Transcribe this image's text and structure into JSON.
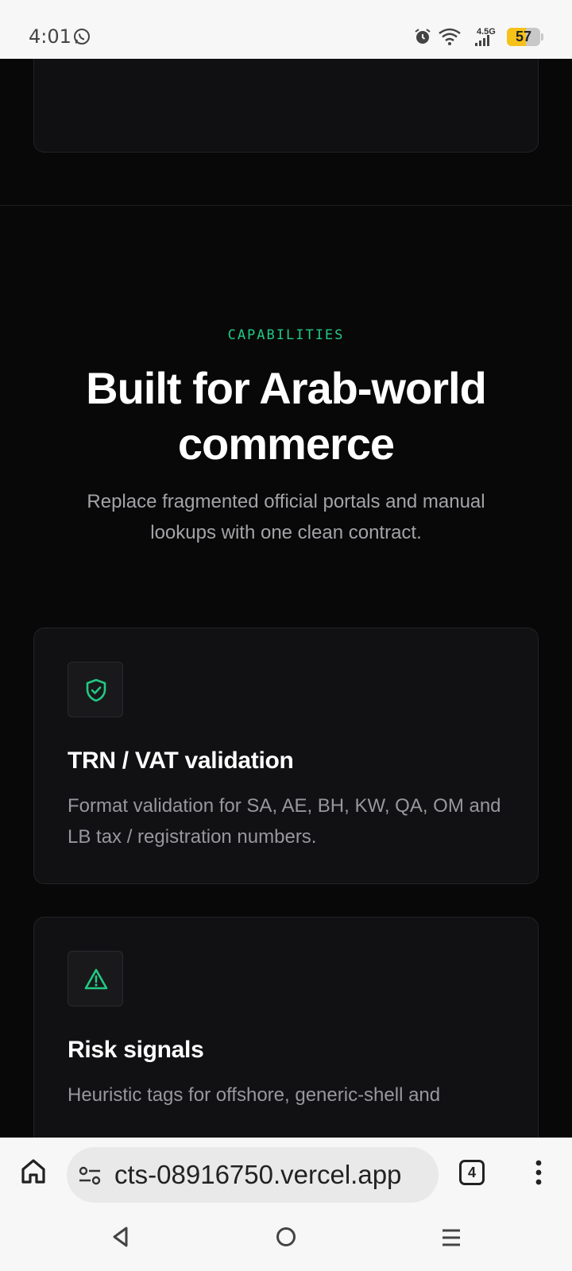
{
  "status_bar": {
    "time": "4:01",
    "network": "4.5G",
    "battery": "57",
    "battery_level": 0.57,
    "icons": [
      "whatsapp-icon",
      "alarm-icon",
      "wifi-icon",
      "signal-icon",
      "battery-icon"
    ]
  },
  "page": {
    "eyebrow": "CAPABILITIES",
    "headline": "Built for Arab-world commerce",
    "subhead": "Replace fragmented official portals and manual lookups with one clean contract.",
    "accent_color": "#22c983",
    "features": [
      {
        "icon": "shield-check-icon",
        "title": "TRN / VAT validation",
        "description": "Format validation for SA, AE, BH, KW, QA, OM and LB tax / registration numbers."
      },
      {
        "icon": "warning-triangle-icon",
        "title": "Risk signals",
        "description": "Heuristic tags for offshore, generic-shell and"
      }
    ]
  },
  "browser": {
    "url_visible": "cts-08916750.vercel.app",
    "tab_count": "4",
    "icons": [
      "home-icon",
      "site-settings-icon",
      "tabs-icon",
      "more-vert-icon"
    ]
  },
  "system_nav": {
    "icons": [
      "back-icon",
      "home-circle-icon",
      "recents-icon"
    ]
  }
}
